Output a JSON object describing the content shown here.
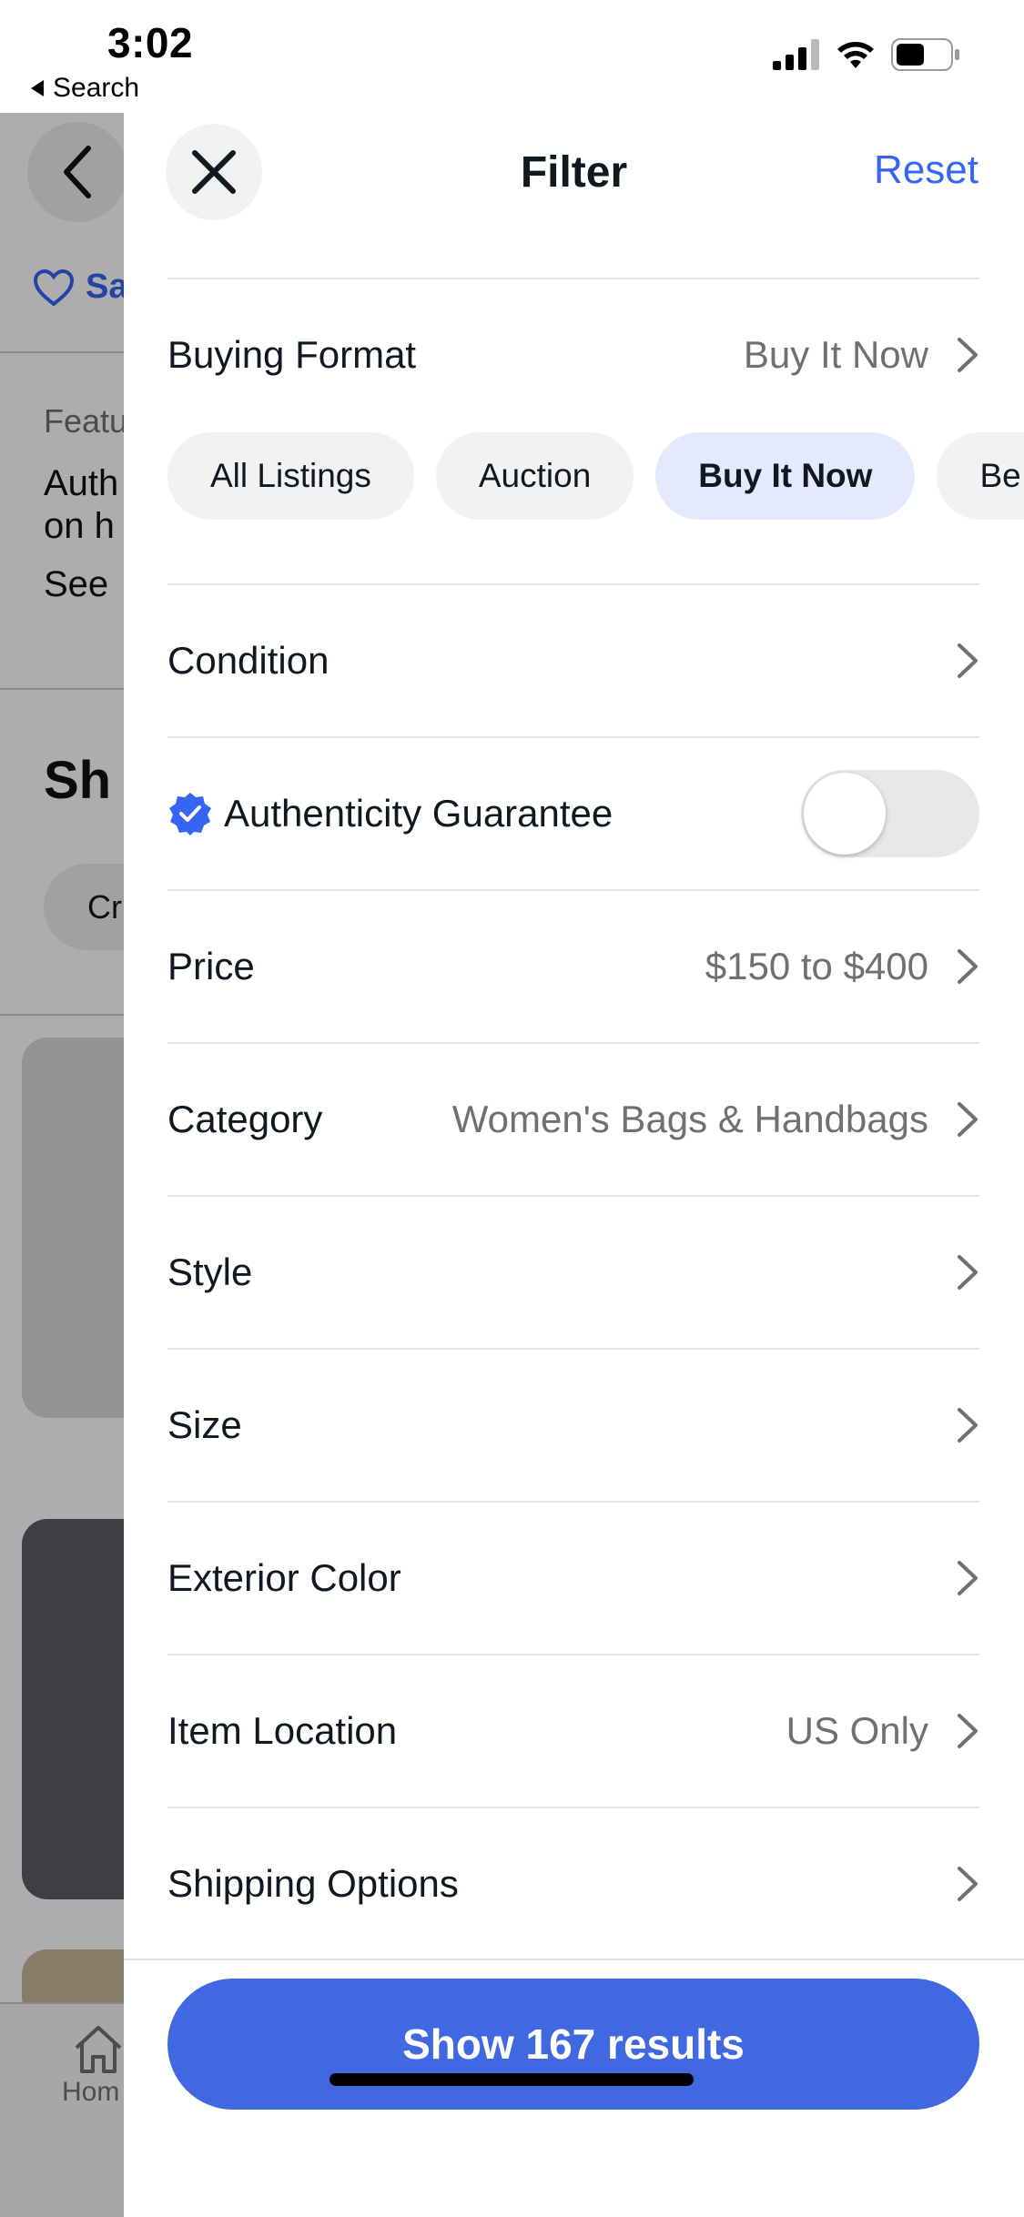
{
  "status_bar": {
    "time": "3:02",
    "back_app_label": "Search",
    "icons": [
      "signal-icon",
      "wifi-icon",
      "battery-icon"
    ]
  },
  "background_page": {
    "save_label": "Sa",
    "featured_label": "Featu",
    "desc_line1": "Auth",
    "desc_line2": "on h",
    "see_label": "See",
    "section_heading": "Sh",
    "chip_label": "Cr",
    "home_tab_label": "Hom"
  },
  "filter": {
    "title": "Filter",
    "reset_label": "Reset",
    "buying_format": {
      "label": "Buying Format",
      "value": "Buy It Now",
      "options": [
        {
          "label": "All Listings",
          "selected": false
        },
        {
          "label": "Auction",
          "selected": false
        },
        {
          "label": "Buy It Now",
          "selected": true
        },
        {
          "label": "Be",
          "selected": false
        }
      ]
    },
    "condition": {
      "label": "Condition",
      "value": ""
    },
    "authenticity": {
      "label": "Authenticity Guarantee",
      "enabled": false
    },
    "price": {
      "label": "Price",
      "value": "$150 to $400"
    },
    "category": {
      "label": "Category",
      "value": "Women's Bags & Handbags"
    },
    "style": {
      "label": "Style",
      "value": ""
    },
    "size": {
      "label": "Size",
      "value": ""
    },
    "exterior_color": {
      "label": "Exterior Color",
      "value": ""
    },
    "item_location": {
      "label": "Item Location",
      "value": "US Only"
    },
    "shipping_options": {
      "label": "Shipping Options",
      "value": ""
    },
    "show_results_label": "Show 167 results"
  },
  "colors": {
    "accent": "#3665f3",
    "cta": "#4069e1",
    "chip_selected": "#e5e9fd"
  }
}
